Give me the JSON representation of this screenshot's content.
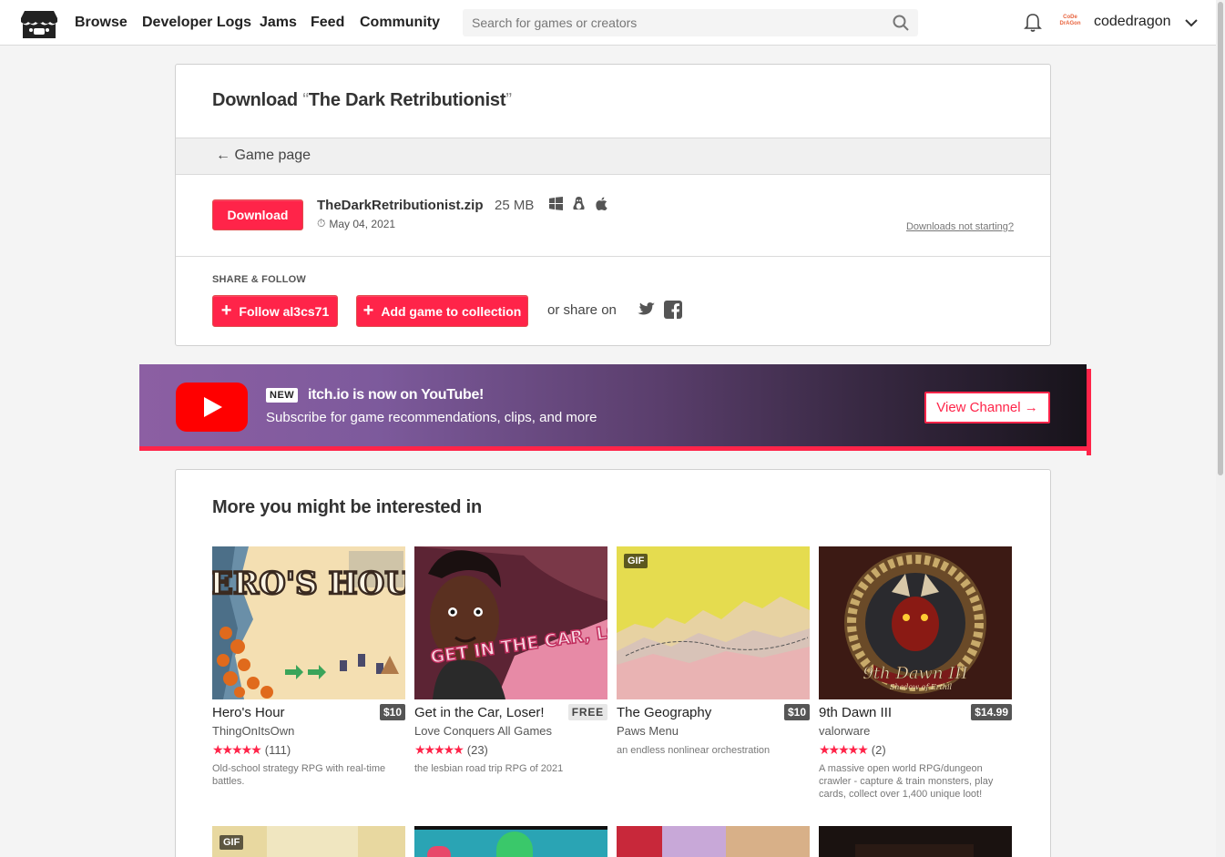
{
  "header": {
    "nav": [
      "Browse",
      "Developer Logs",
      "Jams",
      "Feed",
      "Community"
    ],
    "search_placeholder": "Search for games or creators",
    "username": "codedragon",
    "avatar_text": "CoDe DrAGon"
  },
  "download": {
    "title_prefix": "Download",
    "open_quote": "“",
    "game_title": "The Dark Retributionist",
    "close_quote": "”",
    "back_link": "Game page",
    "button_label": "Download",
    "file_name": "TheDarkRetributionist.zip",
    "file_size": "25 MB",
    "platforms": [
      "windows",
      "linux",
      "macos"
    ],
    "file_date": "May 04, 2021",
    "not_starting": "Downloads not starting?"
  },
  "share": {
    "title": "SHARE & FOLLOW",
    "follow_label": "Follow al3cs71",
    "collect_label": "Add game to collection",
    "share_on": "or share on"
  },
  "youtube": {
    "badge": "NEW",
    "title": "itch.io is now on YouTube!",
    "subtitle": "Subscribe for game recommendations, clips, and more",
    "button": "View Channel →"
  },
  "more": {
    "title": "More you might be interested in",
    "games": [
      {
        "title": "Hero's Hour",
        "price": "$10",
        "author": "ThingOnItsOwn",
        "rating": "(111)",
        "desc": "Old-school strategy RPG with real-time battles.",
        "gif": ""
      },
      {
        "title": "Get in the Car, Loser!",
        "price": "FREE",
        "author": "Love Conquers All Games",
        "rating": "(23)",
        "desc": "the lesbian road trip RPG of 2021",
        "gif": ""
      },
      {
        "title": "The Geography",
        "price": "$10",
        "author": "Paws Menu",
        "rating": "",
        "desc": "an endless nonlinear orchestration",
        "gif": "GIF"
      },
      {
        "title": "9th Dawn III",
        "price": "$14.99",
        "author": "valorware",
        "rating": "(2)",
        "desc": "A massive open world RPG/dungeon crawler - capture & train monsters, play cards, collect over 1,400 unique loot!",
        "gif": ""
      }
    ],
    "row2_gif": "GIF"
  },
  "thumb_text": {
    "heros_hour": "HERO'S HOUR",
    "car_loser": "GET IN THE CAR, LOSER!",
    "ninth_dawn": "9th Dawn III",
    "ninth_dawn_sub": "Shadow of Erthil"
  },
  "colors": {
    "accent": "#ff2449",
    "banner_gradient_start": "#8c5fa3"
  }
}
